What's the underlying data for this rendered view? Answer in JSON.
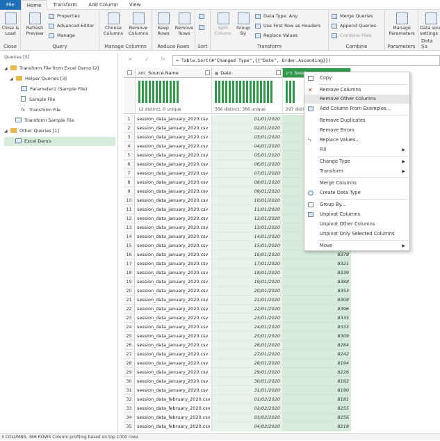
{
  "tabs": [
    "File",
    "Home",
    "Transform",
    "Add Column",
    "View"
  ],
  "ribbon": {
    "close": {
      "button": "Close & Load",
      "label": "Close"
    },
    "query": {
      "refresh": "Refresh Preview",
      "properties": "Properties",
      "advanced": "Advanced Editor",
      "manage": "Manage",
      "label": "Query"
    },
    "manage_columns": {
      "choose": "Choose Columns",
      "remove": "Remove Columns",
      "label": "Manage Columns"
    },
    "reduce_rows": {
      "keep": "Keep Rows",
      "remove": "Remove Rows",
      "label": "Reduce Rows"
    },
    "sort": {
      "label": "Sort"
    },
    "transform": {
      "split": "Split Column",
      "group": "Group By",
      "datatype": "Data Type: Any",
      "firstrow": "Use First Row as Headers",
      "replace": "Replace Values",
      "label": "Transform"
    },
    "combine": {
      "merge": "Merge Queries",
      "append": "Append Queries",
      "files": "Combine Files",
      "label": "Combine"
    },
    "parameters": {
      "manage": "Manage Parameters",
      "label": "Parameters"
    },
    "datasource": {
      "button": "Data source settings",
      "label": "Data So"
    }
  },
  "queries": {
    "header": "Queries [5]",
    "items": [
      {
        "label": "Transform File from Excel Demo [2]"
      },
      {
        "label": "Helper Queries [3]"
      },
      {
        "label": "Parameter1 (Sample File)"
      },
      {
        "label": "Sample File"
      },
      {
        "label": "Transform File"
      },
      {
        "label": "Transform Sample File"
      },
      {
        "label": "Other Queries [1]"
      },
      {
        "label": "Excel Demo"
      }
    ]
  },
  "formula": "= Table.Sort(#\"Changed Type\",{{\"Date\", Order.Ascending}})",
  "grid": {
    "columns": [
      {
        "type": "ABC",
        "name": "Source.Name",
        "profile": "12 distinct, 0 unique"
      },
      {
        "type": "▦",
        "name": "Date",
        "profile": "366 distinct, 366 unique"
      },
      {
        "type": "1²3",
        "name": "Sessi",
        "profile": "297 disti"
      }
    ],
    "rows": [
      [
        "1",
        "session_data_january_2020.csv",
        "01/01/2020",
        ""
      ],
      [
        "2",
        "session_data_january_2020.csv",
        "02/01/2020",
        ""
      ],
      [
        "3",
        "session_data_january_2020.csv",
        "03/01/2020",
        ""
      ],
      [
        "4",
        "session_data_january_2020.csv",
        "04/01/2020",
        ""
      ],
      [
        "5",
        "session_data_january_2020.csv",
        "05/01/2020",
        ""
      ],
      [
        "6",
        "session_data_january_2020.csv",
        "06/01/2020",
        ""
      ],
      [
        "7",
        "session_data_january_2020.csv",
        "07/01/2020",
        ""
      ],
      [
        "8",
        "session_data_january_2020.csv",
        "08/01/2020",
        ""
      ],
      [
        "9",
        "session_data_january_2020.csv",
        "09/01/2020",
        ""
      ],
      [
        "10",
        "session_data_january_2020.csv",
        "10/01/2020",
        ""
      ],
      [
        "11",
        "session_data_january_2020.csv",
        "11/01/2020",
        ""
      ],
      [
        "12",
        "session_data_january_2020.csv",
        "12/01/2020",
        ""
      ],
      [
        "13",
        "session_data_january_2020.csv",
        "13/01/2020",
        ""
      ],
      [
        "14",
        "session_data_january_2020.csv",
        "14/01/2020",
        ""
      ],
      [
        "15",
        "session_data_january_2020.csv",
        "15/01/2020",
        ""
      ],
      [
        "16",
        "session_data_january_2020.csv",
        "16/01/2020",
        "8378"
      ],
      [
        "17",
        "session_data_january_2020.csv",
        "17/01/2020",
        "8321"
      ],
      [
        "18",
        "session_data_january_2020.csv",
        "18/01/2020",
        "8339"
      ],
      [
        "19",
        "session_data_january_2020.csv",
        "19/01/2020",
        "8388"
      ],
      [
        "20",
        "session_data_january_2020.csv",
        "20/01/2020",
        "8353"
      ],
      [
        "21",
        "session_data_january_2020.csv",
        "21/01/2020",
        "8308"
      ],
      [
        "22",
        "session_data_january_2020.csv",
        "22/01/2020",
        "8396"
      ],
      [
        "23",
        "session_data_january_2020.csv",
        "23/01/2020",
        "8335"
      ],
      [
        "24",
        "session_data_january_2020.csv",
        "24/01/2020",
        "8333"
      ],
      [
        "25",
        "session_data_january_2020.csv",
        "25/01/2020",
        "8309"
      ],
      [
        "26",
        "session_data_january_2020.csv",
        "26/01/2020",
        "8284"
      ],
      [
        "27",
        "session_data_january_2020.csv",
        "27/01/2020",
        "8242"
      ],
      [
        "28",
        "session_data_january_2020.csv",
        "28/01/2020",
        "8194"
      ],
      [
        "29",
        "session_data_january_2020.csv",
        "29/01/2020",
        "8226"
      ],
      [
        "30",
        "session_data_january_2020.csv",
        "30/01/2020",
        "8162"
      ],
      [
        "31",
        "session_data_january_2020.csv",
        "31/01/2020",
        "8190"
      ],
      [
        "32",
        "session_data_february_2020.csv",
        "01/02/2020",
        "8181"
      ],
      [
        "33",
        "session_data_february_2020.csv",
        "02/02/2020",
        "8255"
      ],
      [
        "34",
        "session_data_february_2020.csv",
        "03/02/2020",
        "8256"
      ],
      [
        "35",
        "session_data_february_2020.csv",
        "04/02/2020",
        "8218"
      ]
    ]
  },
  "context_menu": {
    "items": [
      {
        "label": "Copy",
        "submenu": false
      },
      {
        "label": "Remove Columns",
        "submenu": false
      },
      {
        "label": "Remove Other Columns",
        "submenu": false
      },
      {
        "label": "Add Column From Examples...",
        "submenu": false
      },
      {
        "label": "Remove Duplicates",
        "submenu": false
      },
      {
        "label": "Remove Errors",
        "submenu": false
      },
      {
        "label": "Replace Values...",
        "submenu": false
      },
      {
        "label": "Fill",
        "submenu": true
      },
      {
        "label": "Change Type",
        "submenu": true
      },
      {
        "label": "Transform",
        "submenu": true
      },
      {
        "label": "Merge Columns",
        "submenu": false
      },
      {
        "label": "Create Data Type",
        "submenu": false
      },
      {
        "label": "Group By...",
        "submenu": false
      },
      {
        "label": "Unpivot Columns",
        "submenu": false
      },
      {
        "label": "Unpivot Other Columns",
        "submenu": false
      },
      {
        "label": "Unpivot Only Selected Columns",
        "submenu": false
      },
      {
        "label": "Move",
        "submenu": true
      }
    ],
    "highlighted": "Remove Other Columns"
  },
  "status": "3 COLUMNS, 366 ROWS    Column profiling based on top 1000 rows",
  "colors": {
    "accent": "#2e9a4a",
    "file_tab": "#1e6fb7",
    "selected_column": "#d6ebd9",
    "folder": "#e8b948"
  }
}
